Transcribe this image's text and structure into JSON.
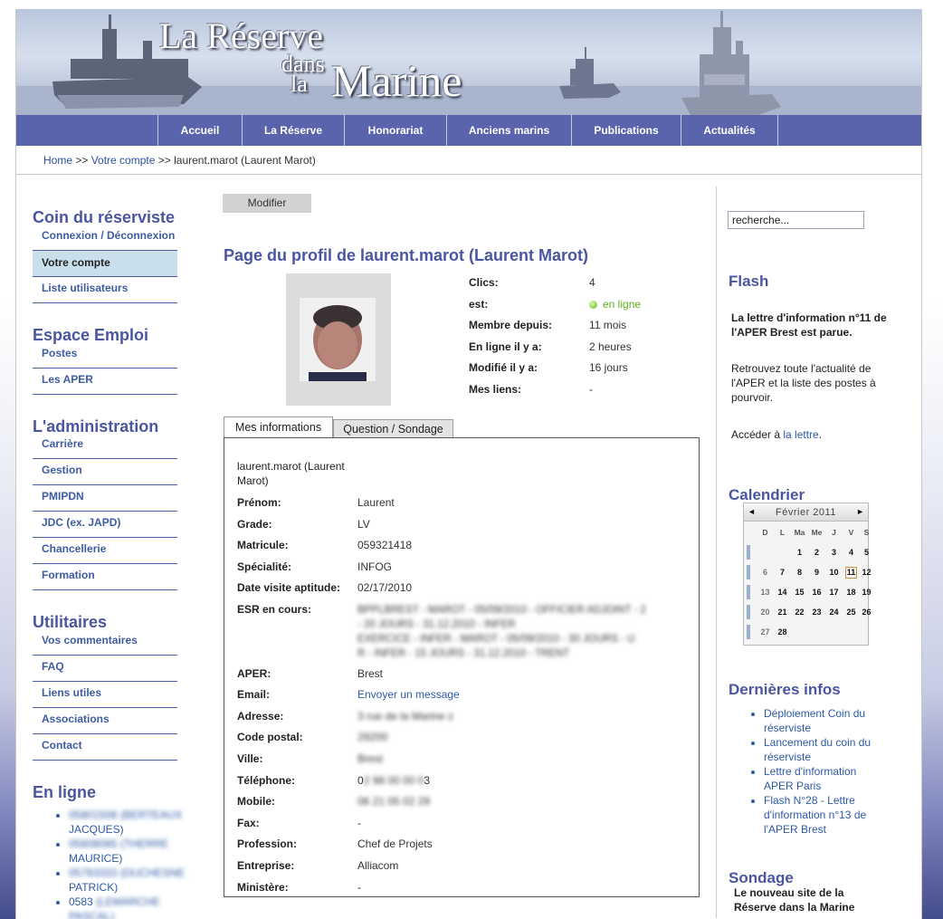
{
  "banner": {
    "title_line1": "La Réserve",
    "title_line2": "dans",
    "title_line3": "la",
    "title_line4": "Marine"
  },
  "nav": {
    "items": [
      {
        "label": "Accueil"
      },
      {
        "label": "La Réserve"
      },
      {
        "label": "Honorariat"
      },
      {
        "label": "Anciens marins"
      },
      {
        "label": "Publications"
      },
      {
        "label": "Actualités"
      }
    ]
  },
  "breadcrumb": {
    "home": "Home",
    "sep1": " >> ",
    "account": "Votre compte",
    "sep2": " >> ",
    "current": "laurent.marot (Laurent Marot)"
  },
  "sidebar": {
    "sections": [
      {
        "title": "Coin du réserviste",
        "items": [
          "Connexion / Déconnexion",
          "Votre compte",
          "Liste utilisateurs"
        ]
      },
      {
        "title": "Espace Emploi",
        "items": [
          "Postes",
          "Les APER"
        ]
      },
      {
        "title": "L'administration",
        "items": [
          "Carrière",
          "Gestion",
          "PMIPDN",
          "JDC (ex. JAPD)",
          "Chancellerie",
          "Formation"
        ]
      },
      {
        "title": "Utilitaires",
        "items": [
          "Vos commentaires",
          "FAQ",
          "Liens utiles",
          "Associations",
          "Contact"
        ]
      }
    ],
    "online_title": "En ligne",
    "online_users": [
      {
        "id": "05801508",
        "name": "(BERTEAUX",
        "tail": "JACQUES)"
      },
      {
        "id": "05608085",
        "name": "(THERRE",
        "tail": "MAURICE)"
      },
      {
        "id": "05783333",
        "name": "(DUCHESNE",
        "tail": "PATRICK)"
      },
      {
        "id": "0583",
        "name": "(LEMARCHE",
        "tail": "PASCAL)"
      }
    ]
  },
  "main": {
    "modify_label": "Modifier",
    "profile_title": "Page du profil de laurent.marot (Laurent Marot)",
    "stats": [
      {
        "label": "Clics:",
        "value": "4"
      },
      {
        "label": "est:",
        "value": "en ligne"
      },
      {
        "label": "Membre depuis:",
        "value": "11 mois"
      },
      {
        "label": "En ligne il y a:",
        "value": "2 heures"
      },
      {
        "label": "Modifié il y a:",
        "value": "16 jours"
      },
      {
        "label": "Mes liens:",
        "value": "-"
      }
    ],
    "tabs": [
      {
        "label": "Mes informations",
        "active": true
      },
      {
        "label": "Question / Sondage",
        "active": false
      }
    ],
    "info_header_line1": "laurent.marot (Laurent",
    "info_header_line2": "Marot)",
    "info": [
      {
        "label": "Prénom:",
        "value": "Laurent"
      },
      {
        "label": "Grade:",
        "value": "LV"
      },
      {
        "label": "Matricule:",
        "value": "059321418"
      },
      {
        "label": "Spécialité:",
        "value": "INFOG"
      },
      {
        "label": "Date visite aptitude:",
        "value": "02/17/2010"
      },
      {
        "label": "ESR en cours:",
        "value_lines": [
          "BPPLBREST - MAROT - 05/09/2010 - OFFICIER ADJOINT - 2",
          "- 20 JOURS - 31.12.2010 - INFER",
          "EXERCICE - INFER - MAROT - 05/09/2010 - 30 JOURS - U",
          "R - INFER - 15 JOURS - 31.12.2010 - TRENT"
        ]
      },
      {
        "label": "APER:",
        "value": "Brest"
      },
      {
        "label": "Email:",
        "value": "Envoyer un message"
      },
      {
        "label": "Adresse:",
        "value": "3 rue de la Marine z"
      },
      {
        "label": "Code postal:",
        "value": "29200"
      },
      {
        "label": "Ville:",
        "value": "Brest"
      },
      {
        "label": "Téléphone:",
        "value_a": "0",
        "value_hidden": "2 98 00 00 0",
        "value_b": "3"
      },
      {
        "label": "Mobile:",
        "value": "06 21 05 02 29"
      },
      {
        "label": "Fax:",
        "value": "-"
      },
      {
        "label": "Profession:",
        "value": "Chef de Projets"
      },
      {
        "label": "Entreprise:",
        "value": "Alliacom"
      },
      {
        "label": "Ministère:",
        "value": "-"
      }
    ]
  },
  "right": {
    "search_value": "recherche...",
    "flash_title": "Flash",
    "flash_bold": "La lettre d'information n°11 de l'APER Brest est parue.",
    "flash_text": "Retrouvez toute l'actualité de l'APER et la liste des postes à pourvoir.",
    "flash_link_prefix": "Accéder à ",
    "flash_link": "la lettre",
    "flash_link_suffix": ".",
    "calendar_title": "Calendrier",
    "calendar": {
      "month": "Février 2011",
      "prev": "◄",
      "next": "►",
      "days_of_week": [
        "D",
        "L",
        "Ma",
        "Me",
        "J",
        "V",
        "S"
      ],
      "weeks": [
        [
          "",
          "",
          "1",
          "2",
          "3",
          "4",
          "5"
        ],
        [
          "6",
          "7",
          "8",
          "9",
          "10",
          "11",
          "12"
        ],
        [
          "13",
          "14",
          "15",
          "16",
          "17",
          "18",
          "19"
        ],
        [
          "20",
          "21",
          "22",
          "23",
          "24",
          "25",
          "26"
        ],
        [
          "27",
          "28",
          "",
          "",
          "",
          "",
          ""
        ]
      ],
      "today": "11"
    },
    "news_title": "Dernières infos",
    "news": [
      "Déploiement Coin du réserviste",
      "Lancement du coin du réserviste",
      "Lettre d'information APER Paris",
      "Flash N°28 - Lettre d'information n°13 de l'APER Brest"
    ],
    "poll_title": "Sondage",
    "poll_text": "Le nouveau site de la Réserve dans la Marine"
  },
  "colors": {
    "nav": "#5a64ad",
    "heading": "#4a56a0",
    "link": "#2c5aa8",
    "active_item": "#c9e0ec",
    "online_dot": "#5fc020"
  }
}
